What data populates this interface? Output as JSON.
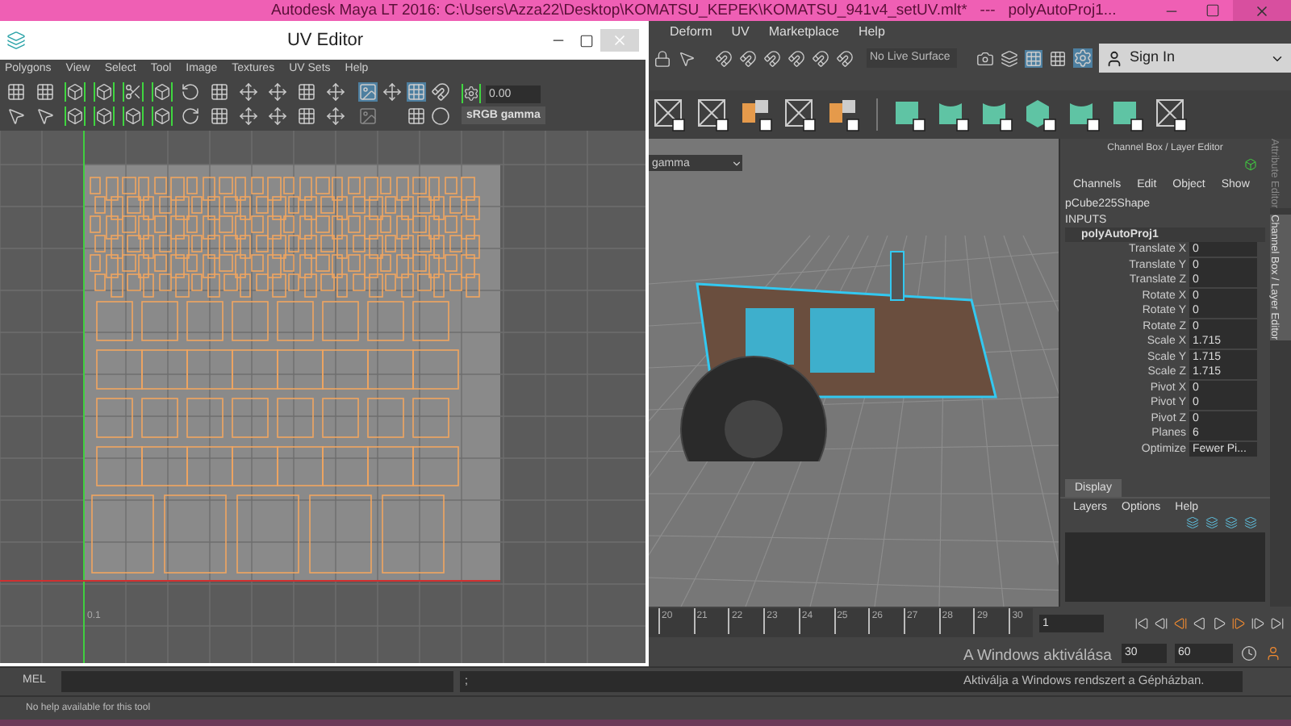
{
  "main_window": {
    "title": "Autodesk Maya LT 2016: C:\\Users\\Azza22\\Desktop\\KOMATSU_KEPEK\\KOMATSU_941v4_setUV.mlt*   ---   polyAutoProj1...",
    "menu": [
      "Deform",
      "UV",
      "Marketplace",
      "Help"
    ],
    "live_surface": "No Live Surface",
    "sign_in": "Sign In"
  },
  "uv_editor": {
    "title": "UV Editor",
    "menu": [
      "Polygons",
      "View",
      "Select",
      "Tool",
      "Image",
      "Textures",
      "UV Sets",
      "Help"
    ],
    "exposure": "0.00",
    "color_space": "sRGB gamma",
    "axis_label": "0.1"
  },
  "viewport": {
    "color_space": "gamma"
  },
  "channel_box": {
    "title": "Channel Box / Layer Editor",
    "menu": [
      "Channels",
      "Edit",
      "Object",
      "Show"
    ],
    "object": "pCube225Shape",
    "section": "INPUTS",
    "node": "polyAutoProj1",
    "attributes": [
      {
        "name": "Translate X",
        "value": "0"
      },
      {
        "name": "Translate Y",
        "value": "0"
      },
      {
        "name": "Translate Z",
        "value": "0"
      },
      {
        "name": "Rotate X",
        "value": "0"
      },
      {
        "name": "Rotate Y",
        "value": "0"
      },
      {
        "name": "Rotate Z",
        "value": "0"
      },
      {
        "name": "Scale X",
        "value": "1.715"
      },
      {
        "name": "Scale Y",
        "value": "1.715"
      },
      {
        "name": "Scale Z",
        "value": "1.715"
      },
      {
        "name": "Pivot X",
        "value": "0"
      },
      {
        "name": "Pivot Y",
        "value": "0"
      },
      {
        "name": "Pivot Z",
        "value": "0"
      },
      {
        "name": "Planes",
        "value": "6"
      },
      {
        "name": "Optimize",
        "value": "Fewer Pi..."
      }
    ],
    "layer_tabs": [
      {
        "label": "Display",
        "selected": true
      }
    ],
    "layer_menu": [
      "Layers",
      "Options",
      "Help"
    ]
  },
  "side_tabs": [
    {
      "label": "Attribute Editor",
      "selected": false
    },
    {
      "label": "Channel Box / Layer Editor",
      "selected": true
    }
  ],
  "timeline": {
    "ticks": [
      "20",
      "21",
      "22",
      "23",
      "24",
      "25",
      "26",
      "27",
      "28",
      "29",
      "30"
    ],
    "current_frame": "1"
  },
  "range": {
    "end_time": "30",
    "max_time": "60"
  },
  "command_line": {
    "language": "MEL",
    "result": ";"
  },
  "help_line": "No help available for this tool",
  "activation_notice": {
    "title": "A Windows aktiválása",
    "message": "Aktiválja a Windows rendszert a Gépházban."
  }
}
